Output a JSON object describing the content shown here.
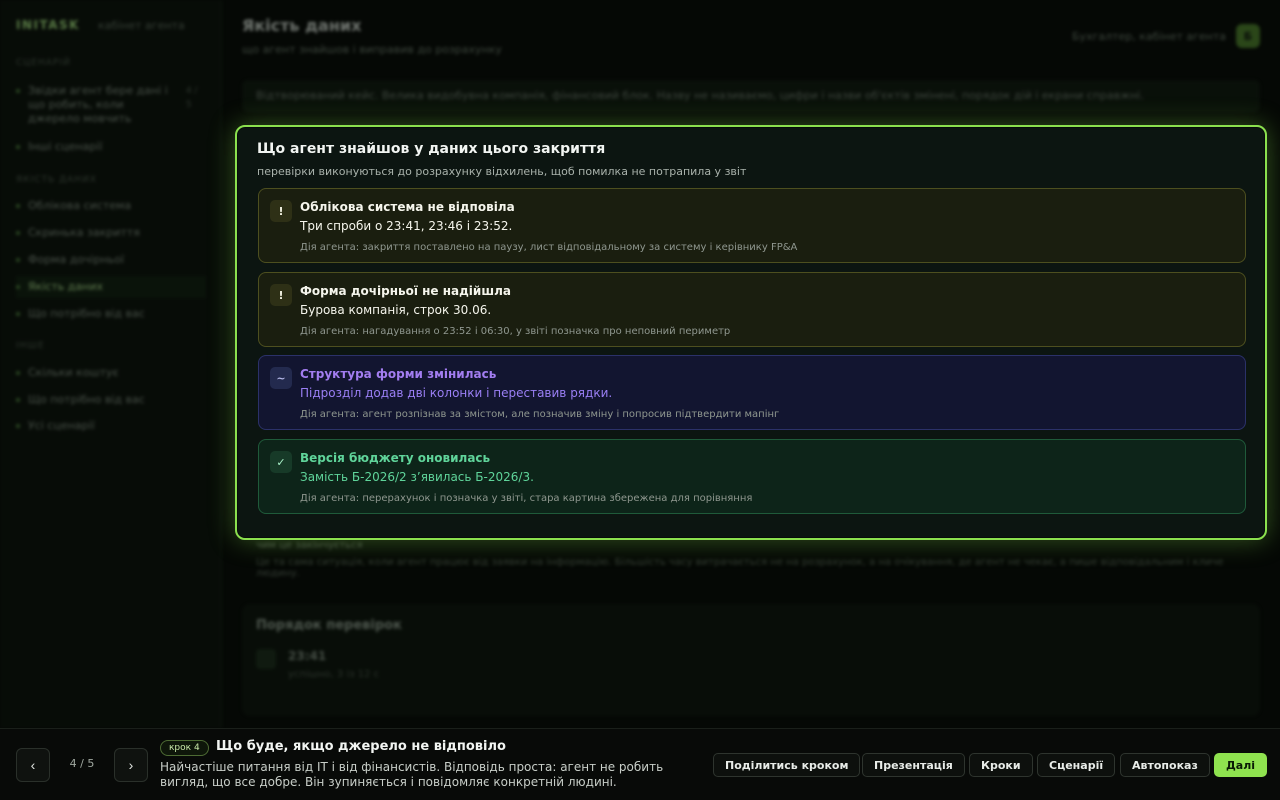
{
  "sidebar": {
    "brand": "INITASK",
    "brand_sub": "кабінет агента",
    "section_scenario": "СЦЕНАРІЙ",
    "scenario_item": "Звідки агент бере дані і що робить, коли джерело мовчить",
    "scenario_item_num": "4 / 5",
    "other_scenarios": "Інші сценарії",
    "section_quality": "ЯКІСТЬ ДАНИХ",
    "quality_items": [
      "Облікова система",
      "Скринька закриття",
      "Форма дочірньої",
      "Якість даних",
      "Що потрібно від вас"
    ],
    "section_misc": "ІНШЕ",
    "misc_items": [
      "Скільки коштує",
      "Що потрібно від вас",
      "Усі сценарії"
    ]
  },
  "header": {
    "title": "Якість даних",
    "subtitle": "що агент знайшов і виправив до розрахунку",
    "user_name": "Бухгалтер, кабінет агента",
    "user_initial": "Б"
  },
  "notice": "Відтворюваний кейс. Велика видобувна компанія, фінансовий блок. Назву не називаємо, цифри і назви об'єктів змінені, порядок дій і екрани справжні.",
  "bg_section": {
    "title": "чим це закінчується",
    "text": "Це та сама ситуація, коли агент працює від заявки на інформацію. Більшість часу витрачається не на розрахунок, а на очікування, де агент не чекає, а пише відповідальним і кличе людину."
  },
  "bg_checks": {
    "title": "Порядок перевірок",
    "time": "23:41",
    "desc": "успішно, 3 із 12 с"
  },
  "panel": {
    "title": "Що агент знайшов у даних цього закриття",
    "subtitle": "перевірки виконуються до розрахунку відхилень, щоб помилка не потрапила у звіт",
    "issues": [
      {
        "icon": "!",
        "title": "Облікова система не відповіла",
        "detail": "Три спроби о 23:41, 23:46 і 23:52.",
        "action": "Дія агента: закриття поставлено на паузу, лист відповідальному за систему і керівнику FP&A"
      },
      {
        "icon": "!",
        "title": "Форма дочірньої не надійшла",
        "detail": "Бурова компанія, строк 30.06.",
        "action": "Дія агента: нагадування о 23:52 і 06:30, у звіті позначка про неповний периметр"
      },
      {
        "icon": "~",
        "title": "Структура форми змінилась",
        "detail": "Підрозділ додав дві колонки і переставив рядки.",
        "action": "Дія агента: агент розпізнав за змістом, але позначив зміну і попросив підтвердити мапінг"
      },
      {
        "icon": "✓",
        "title": "Версія бюджету оновилась",
        "detail": "Замість Б-2026/2 з’явилась Б-2026/3.",
        "action": "Дія агента: перерахунок і позначка у звіті, стара картина збережена для порівняння"
      }
    ]
  },
  "bottom": {
    "prev": "‹",
    "next": "›",
    "current": "4",
    "total": "5",
    "pager_sep": "/",
    "step_chip": "крок 4",
    "step_title": "Що буде, якщо джерело не відповіло",
    "step_desc": "Найчастіше питання від IT і від фінансистів. Відповідь проста: агент не робить вигляд, що все добре. Він зупиняється і повідомляє конкретній людині.",
    "actions": [
      "Поділитись кроком",
      "Презентація",
      "Кроки",
      "Сценарії",
      "Автопоказ"
    ],
    "primary": "Далі"
  }
}
